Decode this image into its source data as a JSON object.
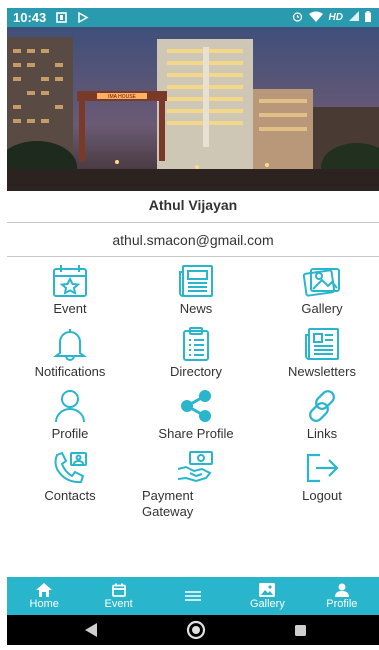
{
  "status": {
    "time": "10:43",
    "network_label": "HD"
  },
  "user": {
    "name": "Athul Vijayan",
    "email": "athul.smacon@gmail.com"
  },
  "hero": {
    "sign_text": "IMA HOUSE"
  },
  "menu": [
    {
      "label": "Event",
      "icon": "calendar-star-icon"
    },
    {
      "label": "News",
      "icon": "newspaper-icon"
    },
    {
      "label": "Gallery",
      "icon": "images-icon"
    },
    {
      "label": "Notifications",
      "icon": "bell-icon"
    },
    {
      "label": "Directory",
      "icon": "clipboard-list-icon"
    },
    {
      "label": "Newsletters",
      "icon": "newsletter-icon"
    },
    {
      "label": "Profile",
      "icon": "person-icon"
    },
    {
      "label": "Share Profile",
      "icon": "share-icon"
    },
    {
      "label": "Links",
      "icon": "link-icon"
    },
    {
      "label": "Contacts",
      "icon": "phone-contact-icon"
    },
    {
      "label": "Payment Gateway",
      "icon": "handshake-payment-icon"
    },
    {
      "label": "Logout",
      "icon": "logout-icon"
    }
  ],
  "bottom_nav": [
    {
      "label": "Home",
      "icon": "home-icon"
    },
    {
      "label": "Event",
      "icon": "calendar-icon"
    },
    {
      "label": "",
      "icon": "menu-icon"
    },
    {
      "label": "Gallery",
      "icon": "image-icon"
    },
    {
      "label": "Profile",
      "icon": "person-icon"
    }
  ],
  "colors": {
    "accent": "#29b6cc",
    "status_bar": "#2a9aae",
    "icon": "#29b6cc"
  }
}
